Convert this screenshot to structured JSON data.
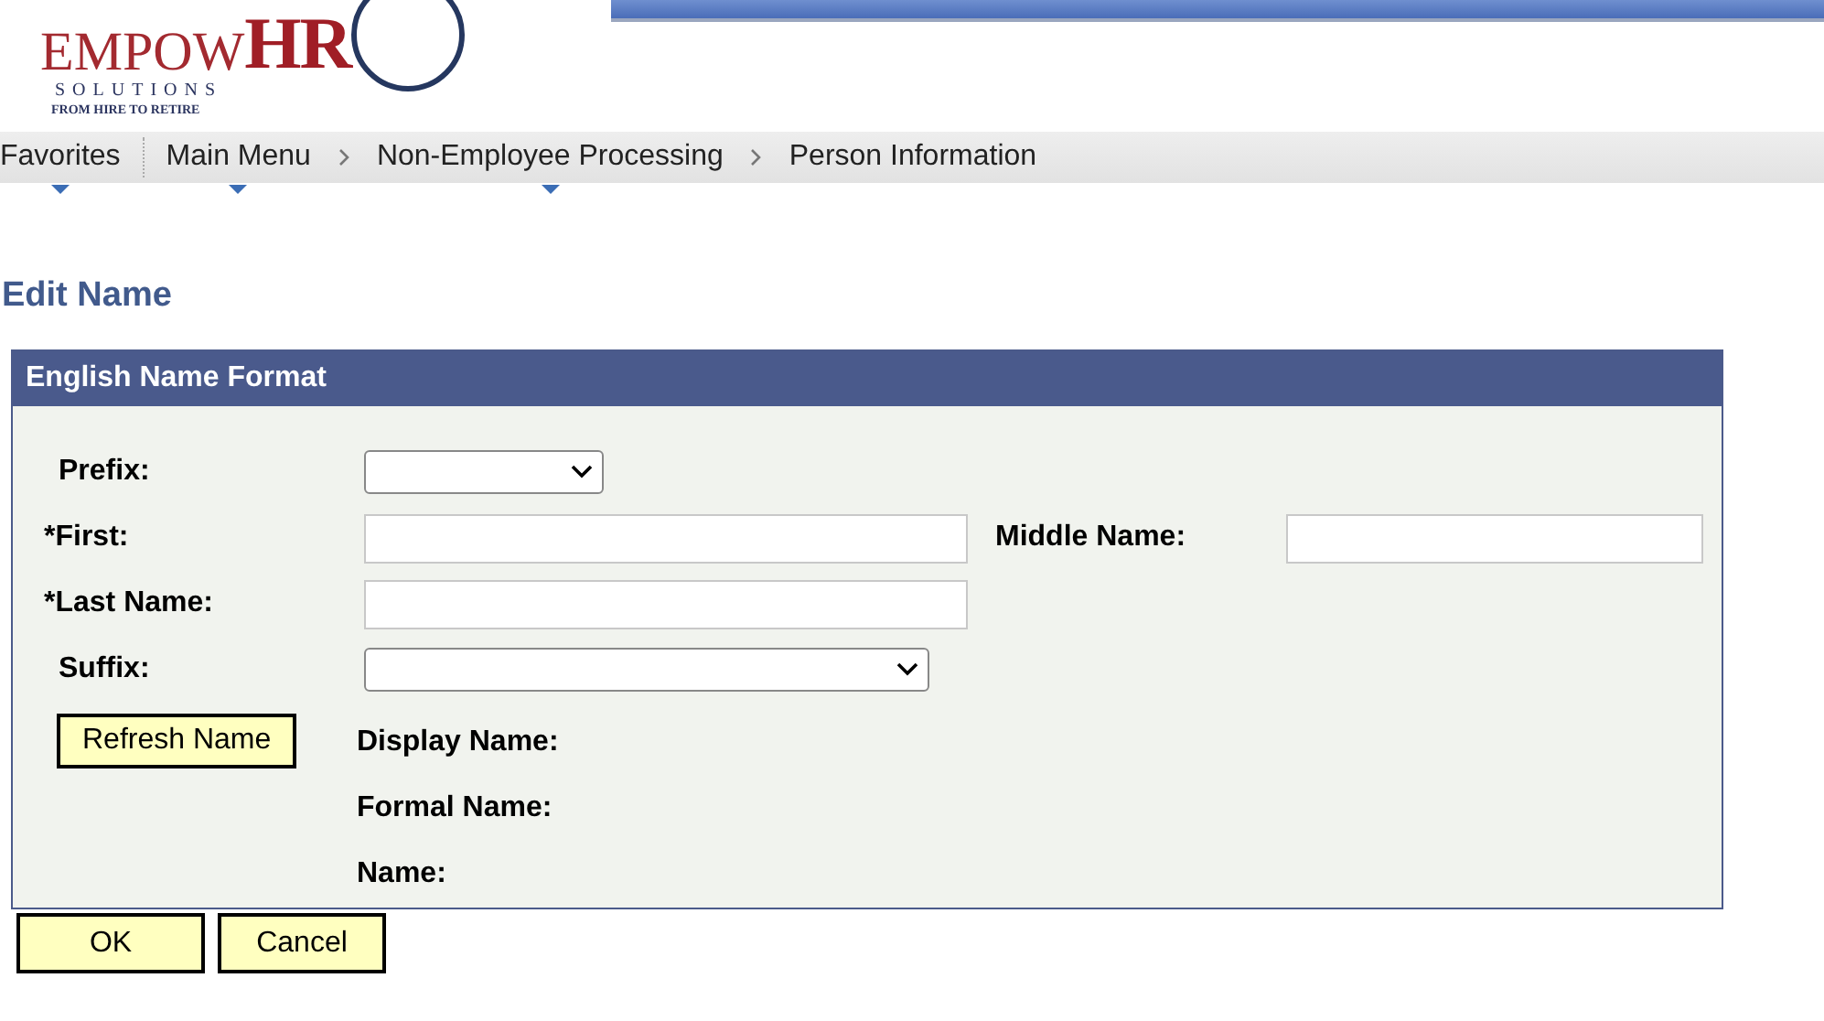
{
  "logo": {
    "word": "EMPOW",
    "accent": "HR",
    "tagline": "SOLUTIONS",
    "motto": "FROM HIRE TO RETIRE"
  },
  "nav": [
    {
      "label": "Favorites",
      "dropdown": true
    },
    {
      "label": "Main Menu",
      "dropdown": true
    },
    {
      "label": "Non-Employee Processing",
      "dropdown": true
    },
    {
      "label": "Person Information",
      "dropdown": false
    }
  ],
  "page_title": "Edit Name",
  "panel": {
    "title": "English Name Format",
    "rows": [
      [
        {
          "label": "Prefix:",
          "required": false,
          "kind": "select"
        }
      ],
      [
        {
          "label": "*First:",
          "required": true,
          "kind": "text"
        },
        {
          "label": "Middle Name:",
          "required": false,
          "kind": "text"
        }
      ],
      [
        {
          "label": "*Last Name:",
          "required": true,
          "kind": "text"
        }
      ],
      [
        {
          "label": "Suffix:",
          "required": false,
          "kind": "select"
        }
      ]
    ],
    "refresh_button": "Refresh Name",
    "display_labels": [
      "Display Name:",
      "Formal Name:",
      "Name:"
    ]
  },
  "buttons": [
    "OK",
    "Cancel"
  ]
}
